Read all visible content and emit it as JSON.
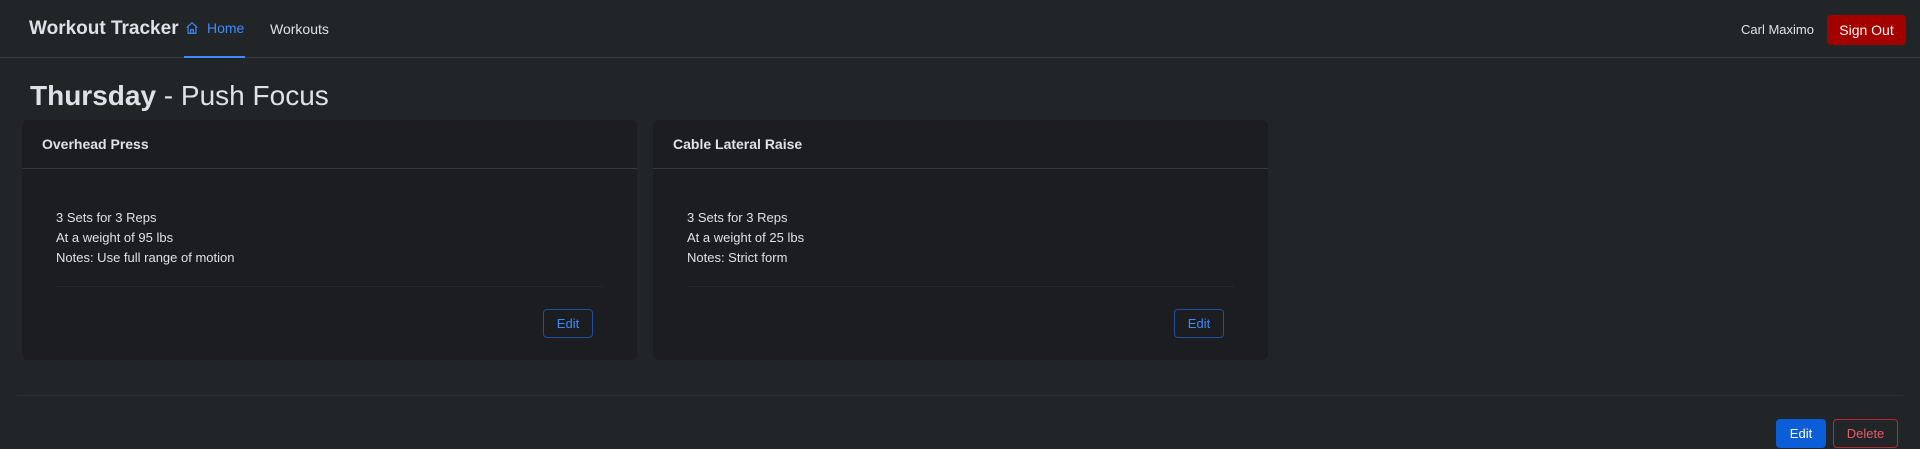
{
  "navbar": {
    "brand": "Workout Tracker",
    "links": [
      {
        "label": "Home",
        "icon": "home-icon",
        "active": true
      },
      {
        "label": "Workouts",
        "active": false
      }
    ],
    "user_name": "Carl Maximo",
    "signout_label": "Sign Out"
  },
  "page": {
    "day": "Thursday",
    "separator": " - ",
    "focus": "Push Focus"
  },
  "exercises": [
    {
      "name": "Overhead Press",
      "sets_line": "3 Sets for 3 Reps",
      "weight_line": "At a weight of 95 lbs",
      "notes_line": "Notes: Use full range of motion",
      "edit_label": "Edit"
    },
    {
      "name": "Cable Lateral Raise",
      "sets_line": "3 Sets for 3 Reps",
      "weight_line": "At a weight of 25 lbs",
      "notes_line": "Notes: Strict form",
      "edit_label": "Edit"
    }
  ],
  "actions": {
    "edit_label": "Edit",
    "delete_label": "Delete"
  },
  "colors": {
    "background": "#212528",
    "card": "#1b1d20",
    "accent": "#3d8bfd",
    "danger": "#a30000",
    "primary_button": "#0b5ed7"
  }
}
